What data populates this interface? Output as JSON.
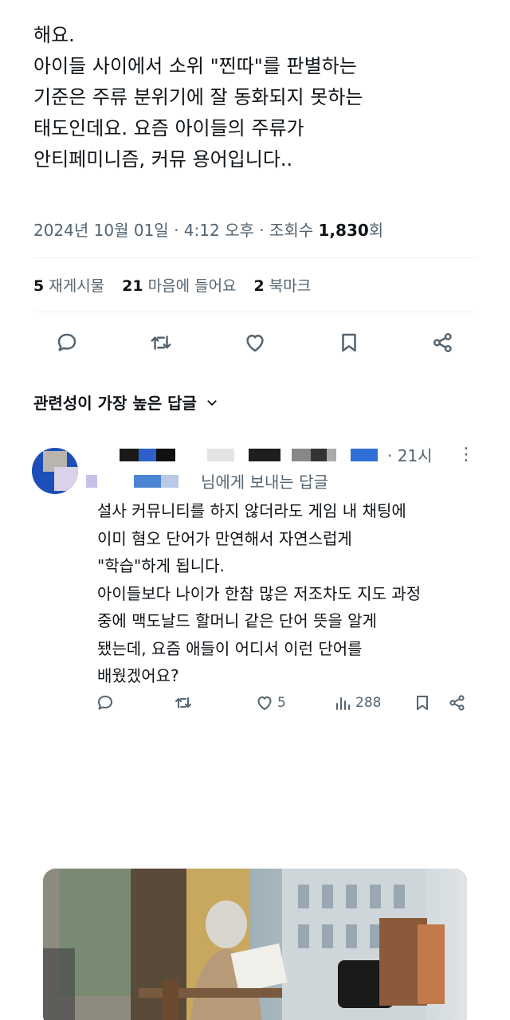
{
  "tweet": {
    "lines": [
      "",
      "해요.",
      "아이들 사이에서 소위 \"찐따\"를 판별하는",
      "기준은 주류 분위기에 잘 동화되지 못하는",
      "태도인데요. 요즘 아이들의 주류가",
      "안티페미니즘, 커뮤 용어입니다.."
    ],
    "meta": {
      "date": "2024년 10월 01일",
      "time": "4:12 오후",
      "views_label": "조회수",
      "views": "1,830",
      "views_unit": "회"
    },
    "stats": {
      "retweets": "5",
      "retweets_label": "재게시물",
      "likes": "21",
      "likes_label": "마음에 들어요",
      "bookmarks": "2",
      "bookmarks_label": "북마크"
    },
    "actions": [
      "reply-icon",
      "retweet-icon",
      "heart-icon",
      "bookmark-icon",
      "share-icon"
    ]
  },
  "replies_sort": {
    "label": "관련성이 가장 높은 답글"
  },
  "reply": {
    "time": "21시",
    "reply_to": "님에게 보내는 답글",
    "lines": [
      "설사 커뮤니티를 하지 않더라도 게임 내 채팅에",
      "이미 혐오 단어가 만연해서 자연스럽게",
      "\"학습\"하게 됩니다.",
      "아이들보다 나이가 한참 많은 저조차도 지도 과정",
      "중에 맥도날드 할머니 같은 단어 뜻을 알게",
      "됐는데, 요즘 애들이 어디서 이런 단어를",
      "배웠겠어요?"
    ],
    "likes": "5",
    "views": "288"
  },
  "colors": {
    "secondary_text": "#536471",
    "primary_text": "#0f1419",
    "divider": "#eff3f4"
  }
}
